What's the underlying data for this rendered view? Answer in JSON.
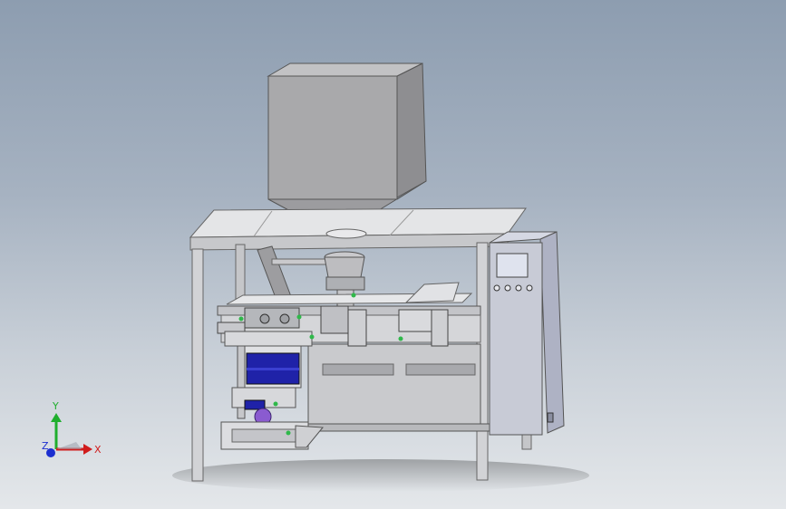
{
  "viewport": {
    "background_top": "#8d9db0",
    "background_bottom": "#e4e7ea"
  },
  "model": {
    "hopper_color": "#a9a9ab",
    "frame_color": "#d2d3d6",
    "panel_color": "#c8cbd6",
    "motor_color": "#1f22a8",
    "accent_purple": "#8a5bd0",
    "accent_green": "#2fb84a"
  },
  "triad": {
    "x_label": "X",
    "y_label": "Y",
    "z_label": "Z",
    "x_color": "#d01c1c",
    "y_color": "#1fae2d",
    "z_color": "#1c2fd0"
  }
}
